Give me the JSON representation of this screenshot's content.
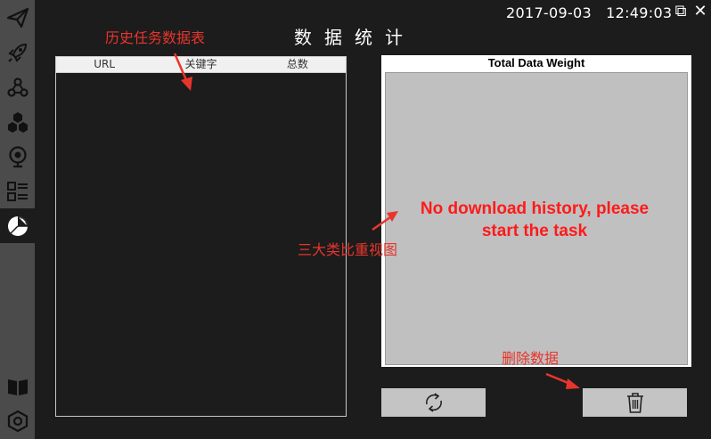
{
  "header": {
    "datetime": "2017-09-03   12:49:03",
    "title": "数据统计",
    "restore_glyph": "⧉",
    "close_glyph": "✕"
  },
  "sidebar": {
    "items": [
      {
        "icon": "paper-plane-icon"
      },
      {
        "icon": "rocket-icon"
      },
      {
        "icon": "webhook-icon"
      },
      {
        "icon": "hexagons-icon"
      },
      {
        "icon": "webcam-icon"
      },
      {
        "icon": "list-icon"
      },
      {
        "icon": "pie-chart-icon",
        "active": true
      },
      {
        "icon": "book-icon"
      },
      {
        "icon": "settings-hexagon-icon"
      }
    ]
  },
  "history_table": {
    "columns": [
      "URL",
      "关键字",
      "总数"
    ],
    "rows": []
  },
  "chart": {
    "title": "Total Data Weight",
    "message_line1": "No download history, please",
    "message_line2": "start the task"
  },
  "buttons": {
    "refresh_icon": "refresh-icon",
    "delete_icon": "trash-icon"
  },
  "annotations": {
    "table": "历史任务数据表",
    "chart": "三大类比重视图",
    "delete": "删除数据"
  },
  "colors": {
    "background": "#1c1c1c",
    "sidebar": "#4b4b4b",
    "annotation": "#e8352c",
    "message": "#ff1a1a",
    "chart_area": "#c0c0c0",
    "button": "#c4c4c4"
  }
}
